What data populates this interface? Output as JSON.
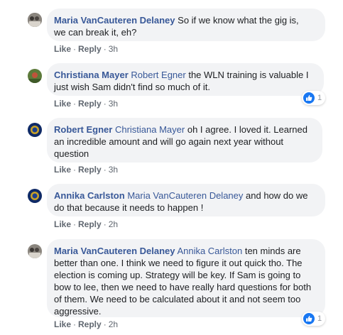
{
  "comments": [
    {
      "author": "Maria VanCauteren Delaney",
      "mention": "",
      "text": "So if we know what the gig is, we can break it, eh?",
      "line1": " So if we know what the gig is,",
      "line2": "we can break it, eh?",
      "like": "Like",
      "reply": "Reply",
      "time": "3h",
      "reactions": null
    },
    {
      "author": "Christiana Mayer",
      "mention": "Robert Egner",
      "text": "the WLN training is valuable I just wish Sam didn't find so much of it.",
      "like": "Like",
      "reply": "Reply",
      "time": "3h",
      "reactions": "1"
    },
    {
      "author": "Robert Egner",
      "mention": "Christiana Mayer",
      "text": "oh I agree. I loved it. Learned an incredible amount and will go again next year without question",
      "like": "Like",
      "reply": "Reply",
      "time": "3h",
      "reactions": null
    },
    {
      "author": "Annika Carlston",
      "mention": "Maria VanCauteren Delaney",
      "text": "and how do we do that because it needs to happen !",
      "like": "Like",
      "reply": "Reply",
      "time": "2h",
      "reactions": null
    },
    {
      "author": "Maria VanCauteren Delaney",
      "mention": "Annika Carlston",
      "text": "ten minds are better than one. I think we need to figure it out quick tho. The election is coming up. Strategy will be key. If Sam is going to bow to lee, then we need to have really hard questions for both of them. We need to be calculated about it and not seem too aggressive.",
      "like": "Like",
      "reply": "Reply",
      "time": "2h",
      "reactions": "1"
    }
  ],
  "separator": "·",
  "colors": {
    "link": "#385898",
    "bubble": "#f2f3f5",
    "meta": "#606770",
    "like_badge": "#1877f2"
  },
  "icons": {
    "reaction": "thumbs-up-icon"
  }
}
